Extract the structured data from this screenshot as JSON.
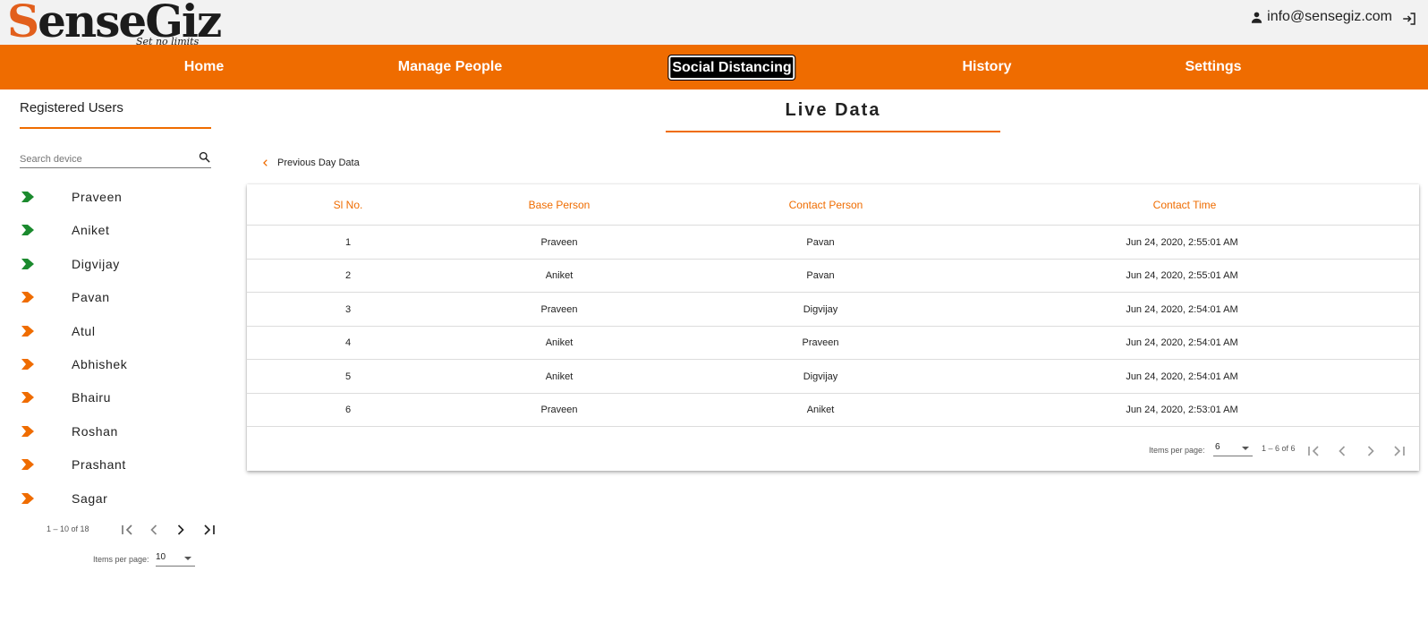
{
  "brand": {
    "name_initial": "S",
    "name_rest": "enseGiz",
    "tagline": "Set no limits"
  },
  "header": {
    "user_email": "info@sensegiz.com"
  },
  "nav": {
    "items": [
      "Home",
      "Manage People",
      "Social Distancing",
      "History",
      "Settings"
    ],
    "active": "Social Distancing"
  },
  "sidebar": {
    "title": "Registered Users",
    "search_placeholder": "Search device",
    "devices": [
      {
        "name": "Praveen",
        "status": "green"
      },
      {
        "name": "Aniket",
        "status": "green"
      },
      {
        "name": "Digvijay",
        "status": "green"
      },
      {
        "name": "Pavan",
        "status": "orange"
      },
      {
        "name": "Atul",
        "status": "orange"
      },
      {
        "name": "Abhishek",
        "status": "orange"
      },
      {
        "name": "Bhairu",
        "status": "orange"
      },
      {
        "name": "Roshan",
        "status": "orange"
      },
      {
        "name": "Prashant",
        "status": "orange"
      },
      {
        "name": "Sagar",
        "status": "orange"
      }
    ],
    "pager": {
      "range": "1 – 10 of 18",
      "items_per_page_label": "Items per page:",
      "items_per_page": "10"
    }
  },
  "main": {
    "title": "Live Data",
    "prev_link": "Previous Day Data",
    "table": {
      "headers": [
        "Sl No.",
        "Base Person",
        "Contact Person",
        "Contact Time"
      ],
      "rows": [
        [
          "1",
          "Praveen",
          "Pavan",
          "Jun 24, 2020, 2:55:01 AM"
        ],
        [
          "2",
          "Aniket",
          "Pavan",
          "Jun 24, 2020, 2:55:01 AM"
        ],
        [
          "3",
          "Praveen",
          "Digvijay",
          "Jun 24, 2020, 2:54:01 AM"
        ],
        [
          "4",
          "Aniket",
          "Praveen",
          "Jun 24, 2020, 2:54:01 AM"
        ],
        [
          "5",
          "Aniket",
          "Digvijay",
          "Jun 24, 2020, 2:54:01 AM"
        ],
        [
          "6",
          "Praveen",
          "Aniket",
          "Jun 24, 2020, 2:53:01 AM"
        ]
      ]
    },
    "pager": {
      "items_per_page_label": "Items per page:",
      "items_per_page": "6",
      "range": "1 – 6 of 6"
    }
  },
  "colors": {
    "accent": "#ef6c00",
    "online": "#1b8a2e",
    "offline": "#ef6c00"
  }
}
